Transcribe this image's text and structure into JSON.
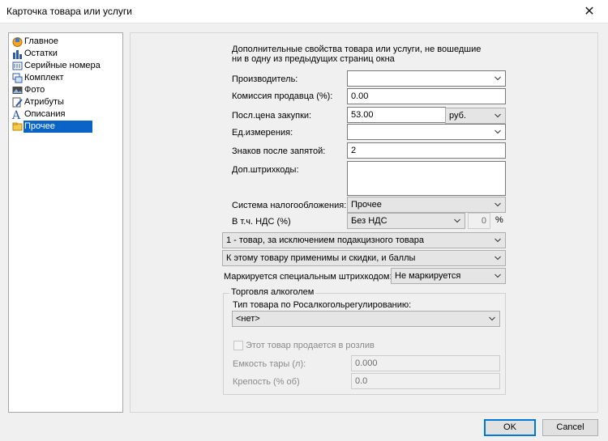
{
  "window": {
    "title": "Карточка товара или услуги",
    "close_glyph": "✕"
  },
  "nav": {
    "items": [
      {
        "label": "Главное",
        "icon": "home-icon"
      },
      {
        "label": "Остатки",
        "icon": "bar-chart-icon"
      },
      {
        "label": "Серийные номера",
        "icon": "serial-number-icon"
      },
      {
        "label": "Комплект",
        "icon": "kit-icon"
      },
      {
        "label": "Фото",
        "icon": "photo-icon"
      },
      {
        "label": "Атрибуты",
        "icon": "attributes-icon"
      },
      {
        "label": "Описания",
        "icon": "text-icon"
      },
      {
        "label": "Прочее",
        "icon": "folder-icon",
        "selected": true
      }
    ]
  },
  "form": {
    "description_line1": "Дополнительные свойства товара или услуги, не вошедшие",
    "description_line2": "ни в одну из предыдущих страниц окна",
    "manufacturer_label": "Производитель:",
    "manufacturer_value": "",
    "commission_label": "Комиссия продавца (%):",
    "commission_value": "0.00",
    "last_price_label": "Посл.цена закупки:",
    "last_price_value": "53.00",
    "currency_value": "руб.",
    "unit_label": "Ед.измерения:",
    "unit_value": "",
    "decimals_label": "Знаков после запятой:",
    "decimals_value": "2",
    "barcodes_label": "Доп.штрихкоды:",
    "barcodes_value": "",
    "tax_system_label": "Система налогообложения:",
    "tax_system_value": "Прочее",
    "vat_label": "В т.ч. НДС (%)",
    "vat_value": "Без НДС",
    "vat_rate_value": "0",
    "vat_percent_sign": "%",
    "product_type_value": "1 - товар, за исключением подакцизного товара",
    "discount_value": "К этому товару применимы и скидки, и баллы",
    "marking_label": "Маркируется специальным штрихкодом:",
    "marking_value": "Не маркируется"
  },
  "alcohol": {
    "group_title": "Торговля алкоголем",
    "type_label": "Тип товара по Росалкогольрегулированию:",
    "type_value": "<нет>",
    "draft_label": "Этот товар продается в розлив",
    "draft_checked": false,
    "capacity_label": "Емкость тары (л):",
    "capacity_value": "0.000",
    "strength_label": "Крепость (% об)",
    "strength_value": "0.0"
  },
  "buttons": {
    "ok_label": "OK",
    "cancel_label": "Cancel"
  },
  "colors": {
    "selection": "#0a64c8",
    "default_button_border": "#0078d7",
    "window_bg": "#f0f0f0"
  }
}
